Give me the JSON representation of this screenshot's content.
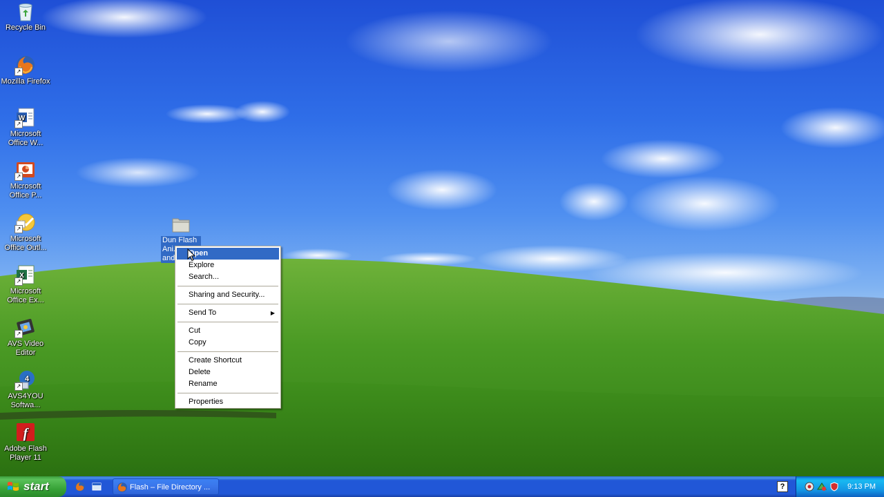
{
  "desktop": {
    "icons": [
      {
        "label": "Recycle Bin"
      },
      {
        "label": "Mozilla Firefox"
      },
      {
        "label": "Microsoft Office W..."
      },
      {
        "label": "Microsoft Office P..."
      },
      {
        "label": "Microsoft Office Outl..."
      },
      {
        "label": "Microsoft Office Ex..."
      },
      {
        "label": "AVS Video Editor"
      },
      {
        "label": "AVS4YOU Softwa..."
      },
      {
        "label": "Adobe Flash Player 11"
      }
    ],
    "selected_folder": {
      "label": "Dun Flash Ani... and..."
    }
  },
  "context_menu": {
    "items": [
      {
        "label": "Open"
      },
      {
        "label": "Explore"
      },
      {
        "label": "Search..."
      },
      {
        "label": "Sharing and Security..."
      },
      {
        "label": "Send To"
      },
      {
        "label": "Cut"
      },
      {
        "label": "Copy"
      },
      {
        "label": "Create Shortcut"
      },
      {
        "label": "Delete"
      },
      {
        "label": "Rename"
      },
      {
        "label": "Properties"
      }
    ]
  },
  "taskbar": {
    "start_label": "start",
    "task_button_label": "Flash – File Directory ...",
    "help_label": "?",
    "clock": "9:13 PM"
  },
  "colors": {
    "selection": "#316ac5",
    "taskbar": "#2157d7",
    "start_button": "#38a338",
    "tray": "#1493e3"
  }
}
